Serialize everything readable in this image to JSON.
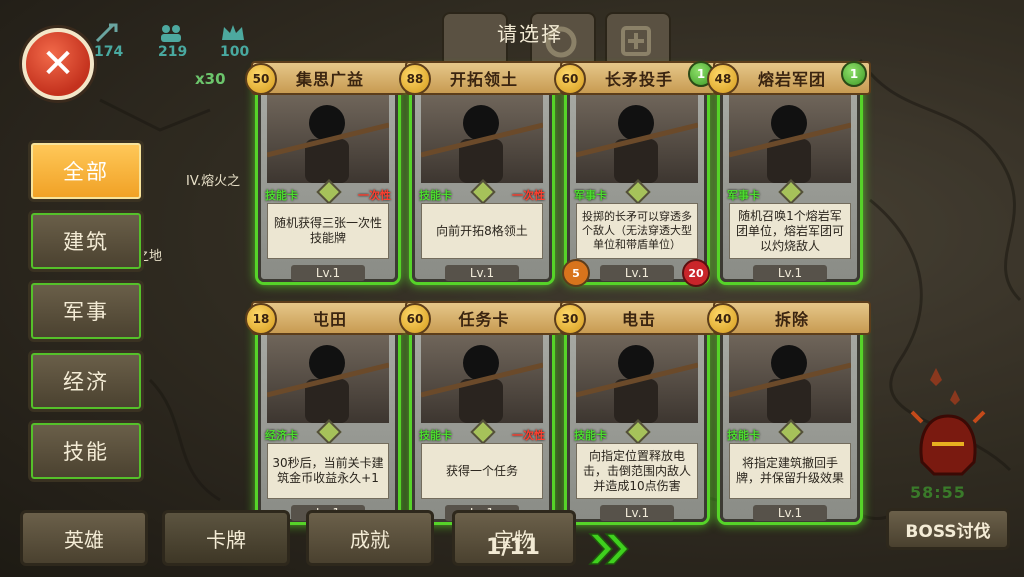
{
  "header": {
    "title": "请选择",
    "resources": [
      {
        "icon": "sword-icon",
        "value": "174"
      },
      {
        "icon": "soldiers-icon",
        "value": "219"
      },
      {
        "icon": "crown-icon",
        "value": "100"
      }
    ],
    "multiplier": "x30"
  },
  "map_labels": [
    "IV.熔火之",
    "之地"
  ],
  "sidebar": {
    "items": [
      {
        "label": "全部",
        "active": true
      },
      {
        "label": "建筑",
        "active": false
      },
      {
        "label": "军事",
        "active": false
      },
      {
        "label": "经济",
        "active": false
      },
      {
        "label": "技能",
        "active": false
      }
    ]
  },
  "cards": [
    {
      "name": "集思广益",
      "cost": "50",
      "type": "技能卡",
      "once": "一次性",
      "badge": "",
      "desc": "随机获得三张一次性技能牌",
      "level": "Lv.1"
    },
    {
      "name": "开拓领土",
      "cost": "88",
      "type": "技能卡",
      "once": "一次性",
      "badge": "",
      "desc": "向前开拓8格领土",
      "level": "Lv.1"
    },
    {
      "name": "长矛投手",
      "cost": "60",
      "type": "军事卡",
      "once": "",
      "badge": "1",
      "desc": "投掷的长矛可以穿透多个敌人（无法穿透大型单位和带盾单位）",
      "level": "Lv.1",
      "attack": "5",
      "hp": "20"
    },
    {
      "name": "熔岩军团",
      "cost": "48",
      "type": "军事卡",
      "once": "",
      "badge": "1",
      "desc": "随机召唤1个熔岩军团单位，熔岩军团可以灼烧敌人",
      "level": "Lv.1"
    },
    {
      "name": "屯田",
      "cost": "18",
      "type": "经济卡",
      "once": "",
      "badge": "",
      "desc": "30秒后，当前关卡建筑金币收益永久+1",
      "level": "Lv.1"
    },
    {
      "name": "任务卡",
      "cost": "60",
      "type": "技能卡",
      "once": "一次性",
      "badge": "",
      "desc": "获得一个任务",
      "level": "Lv.1"
    },
    {
      "name": "电击",
      "cost": "30",
      "type": "技能卡",
      "once": "",
      "badge": "",
      "desc": "向指定位置释放电击，击倒范围内敌人并造成10点伤害",
      "level": "Lv.1"
    },
    {
      "name": "拆除",
      "cost": "40",
      "type": "技能卡",
      "once": "",
      "badge": "",
      "desc": "将指定建筑撤回手牌，并保留升级效果",
      "level": "Lv.1"
    }
  ],
  "bottom_tabs": [
    {
      "label": "英雄"
    },
    {
      "label": "卡牌"
    },
    {
      "label": "成就"
    },
    {
      "label": "宝物"
    }
  ],
  "pagination": "1/11",
  "boss": {
    "timer": "58:55",
    "label": "BOSS讨伐"
  },
  "colors": {
    "accent_green": "#56d329",
    "active_tab": "#f0a024",
    "once_red": "#ff4030"
  }
}
